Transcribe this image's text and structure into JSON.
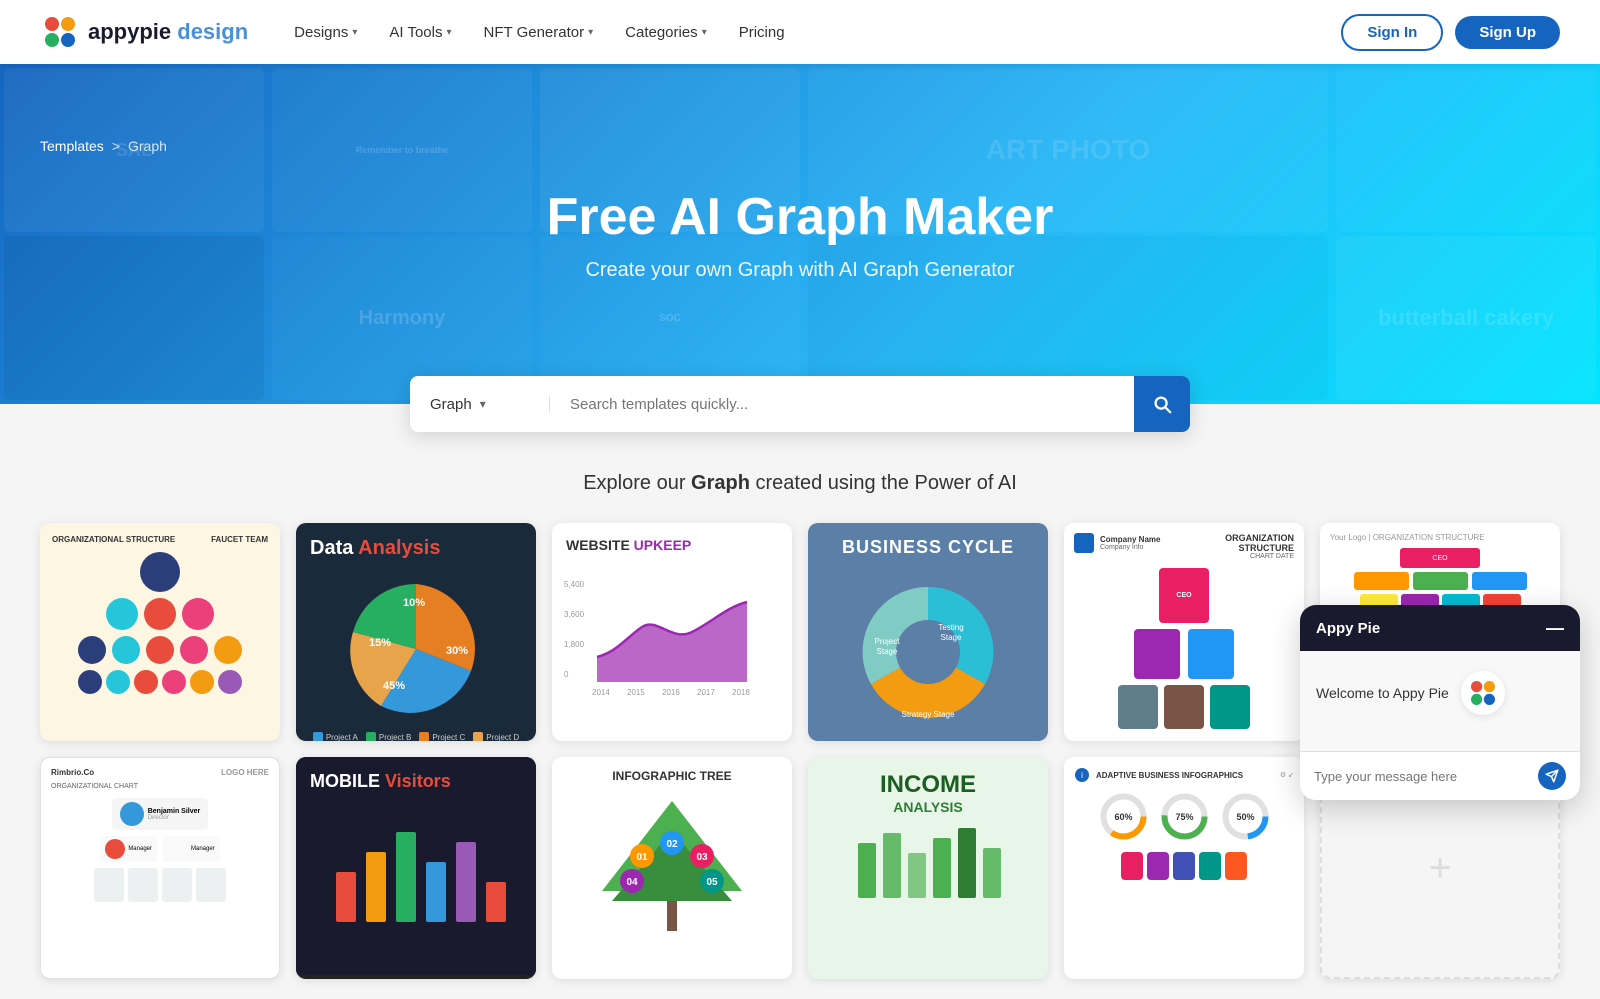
{
  "navbar": {
    "logo_text": "appypie design",
    "nav_items": [
      {
        "label": "Designs",
        "has_dropdown": true
      },
      {
        "label": "AI Tools",
        "has_dropdown": true
      },
      {
        "label": "NFT Generator",
        "has_dropdown": true
      },
      {
        "label": "Categories",
        "has_dropdown": true
      },
      {
        "label": "Pricing",
        "has_dropdown": false
      }
    ],
    "signin_label": "Sign In",
    "signup_label": "Sign Up"
  },
  "breadcrumb": {
    "templates_label": "Templates",
    "separator": ">",
    "current": "Graph"
  },
  "hero": {
    "title": "Free AI Graph Maker",
    "subtitle": "Create your own Graph with AI Graph Generator"
  },
  "search": {
    "dropdown_label": "Graph",
    "placeholder": "Search templates quickly..."
  },
  "explore": {
    "prefix": "Explore our ",
    "keyword": "Graph",
    "suffix": " created using the Power of AI"
  },
  "templates": [
    {
      "id": "org-structure",
      "title": "ORGANIZATIONAL STRUCTURE",
      "type": "org-tree"
    },
    {
      "id": "data-analysis",
      "title": "Data",
      "title2": "Analysis",
      "type": "pie-chart"
    },
    {
      "id": "website-upkeep",
      "title": "WEBSITE",
      "title2": "UPKEEP",
      "type": "area-chart"
    },
    {
      "id": "business-cycle",
      "title": "BUSINESS CYCLE",
      "type": "donut-chart"
    },
    {
      "id": "org-structure-2",
      "title": "ORGANIZATION STRUCTURE",
      "type": "org-tree-2"
    },
    {
      "id": "org-structure-3",
      "title": "ORGANIZATION STRUCTURE",
      "type": "org-tree-3"
    },
    {
      "id": "rimbrio",
      "title": "Rimbrio.Co",
      "type": "org-chart-small"
    },
    {
      "id": "mobile-visitors",
      "title": "MOBILE",
      "title2": "Visitors",
      "type": "dark-card"
    },
    {
      "id": "infographic-tree",
      "title": "INFOGRAPHIC TREE",
      "type": "info-tree"
    },
    {
      "id": "income-analysis",
      "title": "INCOME",
      "title2": "ANALYSIS",
      "type": "income"
    },
    {
      "id": "adaptive-business",
      "title": "ADAPTIVE BUSINESS INFOGRAPHICS",
      "type": "adaptive"
    },
    {
      "id": "placeholder",
      "title": "",
      "type": "empty"
    }
  ],
  "chat": {
    "header_title": "Appy Pie",
    "welcome_text": "Welcome to Appy Pie",
    "input_placeholder": "Type your message here",
    "close_label": "—"
  },
  "colors": {
    "primary_blue": "#1565c0",
    "light_blue": "#29b6f6",
    "teal": "#26c6da",
    "orange": "#f39c12",
    "red": "#e74c3c",
    "green": "#27ae60",
    "dark_bg": "#1a2a3a",
    "accent_purple": "#9c27b0"
  }
}
